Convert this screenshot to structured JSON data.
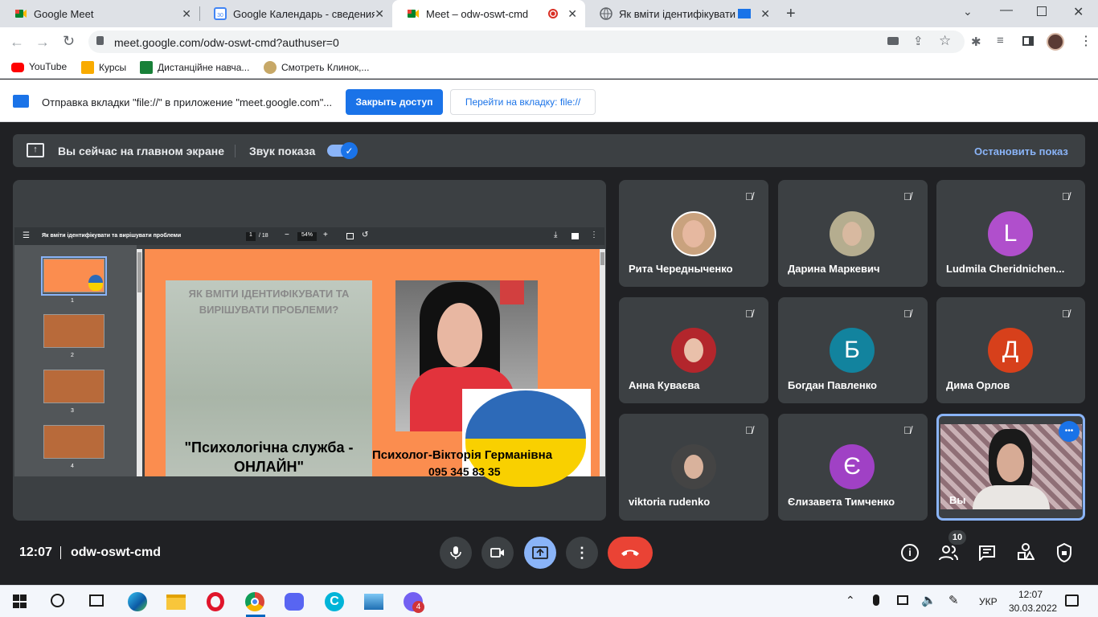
{
  "tabs": [
    {
      "title": "Google Meet"
    },
    {
      "title": "Google Календарь - сведения о"
    },
    {
      "title": "Meet – odw-oswt-cmd"
    },
    {
      "title": "Як вміти ідентифікувати та"
    }
  ],
  "url": "meet.google.com/odw-oswt-cmd?authuser=0",
  "bookmarks": [
    "YouTube",
    "Курсы",
    "Дистанційне навча...",
    "Смотреть Клинок,..."
  ],
  "share_notice": {
    "text": "Отправка вкладки \"file://\" в приложение \"meet.google.com\"...",
    "stop_label": "Закрыть доступ",
    "goto_label": "Перейти на вкладку: file://"
  },
  "banner": {
    "main_screen": "Вы сейчас на главном экране",
    "sound_label": "Звук показа",
    "stop_show": "Остановить показ"
  },
  "pdf": {
    "title": "Як вміти ідентифікувати та вирішувати проблеми",
    "page": "1",
    "total": "/ 18",
    "zoom": "54%",
    "thumbs": [
      "1",
      "2",
      "3",
      "4"
    ]
  },
  "slide": {
    "heading": "ЯК ВМІТИ ІДЕНТИФІКУВАТИ ТА ВИРІШУВАТИ ПРОБЛЕМИ?",
    "service": "\"Психологічна служба - ОНЛАЙН\"",
    "psychologist": "Психолог-Вікторія Германівна",
    "phone": "095 345 83 35"
  },
  "participants": [
    {
      "name": "Рита Чередныченко",
      "letter": "",
      "color": "#c9a27e"
    },
    {
      "name": "Дарина Маркевич",
      "letter": "",
      "color": "#a69a7a"
    },
    {
      "name": "Ludmila Cheridnichen...",
      "letter": "L",
      "color": "#b04fcc"
    },
    {
      "name": "Анна Куваєва",
      "letter": "",
      "color": "#b3262c"
    },
    {
      "name": "Богдан Павленко",
      "letter": "Б",
      "color": "#12839e"
    },
    {
      "name": "Дима Орлов",
      "letter": "Д",
      "color": "#d7401b"
    },
    {
      "name": "viktoria rudenko",
      "letter": "",
      "color": "#444444"
    },
    {
      "name": "Єлизавета Тимченко",
      "letter": "Є",
      "color": "#a041c5"
    },
    {
      "name": "Вы",
      "letter": "",
      "color": "#8f6f76"
    }
  ],
  "meeting": {
    "time": "12:07",
    "code": "odw-oswt-cmd",
    "people_count": "10"
  },
  "taskbar": {
    "lang": "УКР",
    "time": "12:07",
    "date": "30.03.2022",
    "viber_badge": "4"
  }
}
